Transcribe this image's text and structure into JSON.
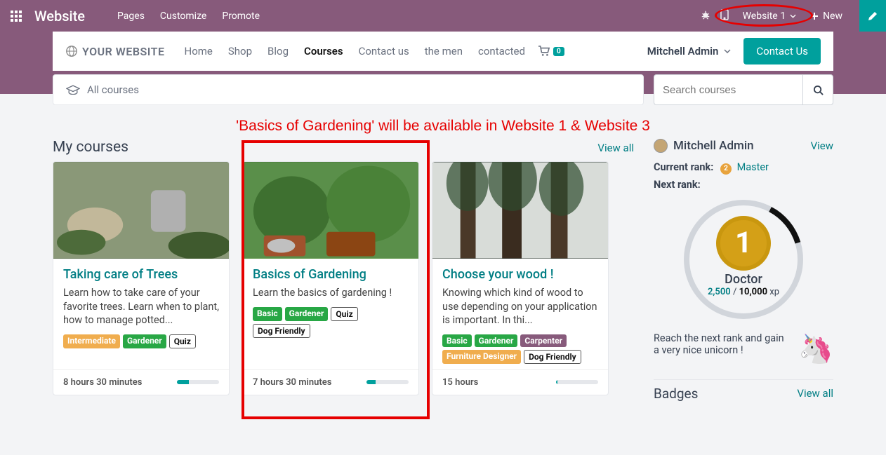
{
  "topbar": {
    "brand": "Website",
    "nav": [
      "Pages",
      "Customize",
      "Promote"
    ],
    "site_switcher": "Website 1",
    "new_label": "New"
  },
  "subheader": {
    "logo_text": "YOUR WEBSITE",
    "nav": {
      "home": "Home",
      "shop": "Shop",
      "blog": "Blog",
      "courses": "Courses",
      "contactus": "Contact us",
      "themen": "the men",
      "contacted": "contacted"
    },
    "cart_count": "0",
    "user": "Mitchell Admin",
    "contact_btn": "Contact Us"
  },
  "filter": {
    "all_courses": "All courses",
    "search_placeholder": "Search courses"
  },
  "annotation": "'Basics of Gardening' will be available in Website 1 & Website 3",
  "section": {
    "title": "My courses",
    "view_all": "View all"
  },
  "courses": [
    {
      "title": "Taking care of Trees",
      "desc": "Learn how to take care of your favorite trees. Learn when to plant, how to manage potted...",
      "tags": [
        {
          "text": "Intermediate",
          "cls": "yellow"
        },
        {
          "text": "Gardener",
          "cls": "green"
        },
        {
          "text": "Quiz",
          "cls": "outline"
        }
      ],
      "duration": "8 hours 30 minutes",
      "progress": 28
    },
    {
      "title": "Basics of Gardening",
      "desc": "Learn the basics of gardening !",
      "tags": [
        {
          "text": "Basic",
          "cls": "green"
        },
        {
          "text": "Gardener",
          "cls": "green"
        },
        {
          "text": "Quiz",
          "cls": "outline"
        },
        {
          "text": "Dog Friendly",
          "cls": "outline"
        }
      ],
      "duration": "7 hours 30 minutes",
      "progress": 22
    },
    {
      "title": "Choose your wood !",
      "desc": "Knowing which kind of wood to use depending on your application is important. In thi...",
      "tags": [
        {
          "text": "Basic",
          "cls": "green"
        },
        {
          "text": "Gardener",
          "cls": "green"
        },
        {
          "text": "Carpenter",
          "cls": "purple"
        },
        {
          "text": "Furniture Designer",
          "cls": "yellow"
        },
        {
          "text": "Dog Friendly",
          "cls": "outline"
        }
      ],
      "duration": "15 hours",
      "progress": 4
    }
  ],
  "sidebar": {
    "user": "Mitchell Admin",
    "view": "View",
    "current_rank_lbl": "Current rank:",
    "current_rank_val": "Master",
    "current_rank_badge": "2",
    "next_rank_lbl": "Next rank:",
    "medal_num": "1",
    "rank_name": "Doctor",
    "xp_current": "2,500",
    "xp_sep": " / ",
    "xp_total": "10,000",
    "xp_suffix": " xp",
    "motivation": "Reach the next rank and gain a very nice unicorn !",
    "badges_title": "Badges",
    "badges_view_all": "View all"
  }
}
